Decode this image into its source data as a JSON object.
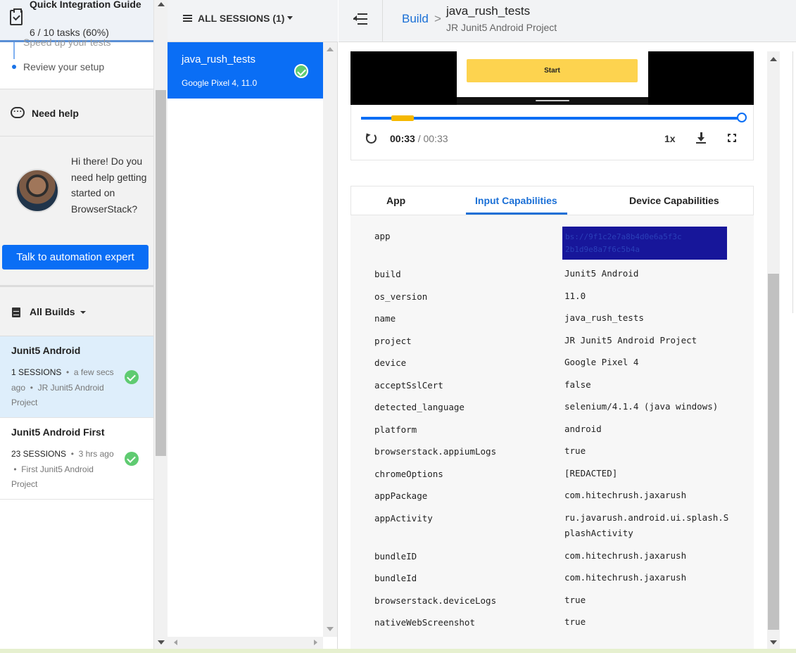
{
  "sidebar": {
    "guide": {
      "title": "Quick Integration Guide",
      "progress": "6 / 10 tasks (60%)",
      "prev_step": "Speed up your tests",
      "current_step": "Review your setup"
    },
    "help": {
      "heading": "Need help",
      "message": "Hi there! Do you need help getting started on BrowserStack?",
      "button": "Talk to automation expert"
    },
    "builds": {
      "heading": "All Builds",
      "items": [
        {
          "name": "Junit5 Android",
          "count": "1 SESSIONS",
          "meta": "a few secs ago",
          "project": "JR Junit5 Android Project"
        },
        {
          "name": "Junit5 Android First",
          "count": "23 SESSIONS",
          "meta": "3 hrs ago",
          "project": "First Junit5 Android Project"
        }
      ]
    }
  },
  "sessions": {
    "header": "ALL SESSIONS (1)",
    "items": [
      {
        "name": "java_rush_tests",
        "device": "Google Pixel 4, 11.0"
      }
    ]
  },
  "topbar": {
    "crumb_build": "Build",
    "crumb_sep": ">",
    "title": "java_rush_tests",
    "subtitle": "JR Junit5 Android Project"
  },
  "video": {
    "button_label": "Start",
    "current_time": "00:33",
    "total_time": "/ 00:33",
    "speed": "1x",
    "progress_fraction": 1.0
  },
  "tabs": {
    "app": "App",
    "input": "Input Capabilities",
    "device": "Device Capabilities",
    "active": "Input Capabilities"
  },
  "capabilities": [
    {
      "key": "app",
      "value": ""
    },
    {
      "key": "build",
      "value": "Junit5 Android"
    },
    {
      "key": "os_version",
      "value": "11.0"
    },
    {
      "key": "name",
      "value": "java_rush_tests"
    },
    {
      "key": "project",
      "value": "JR Junit5 Android Project"
    },
    {
      "key": "device",
      "value": "Google Pixel 4"
    },
    {
      "key": "acceptSslCert",
      "value": "false"
    },
    {
      "key": "detected_language",
      "value": "selenium/4.1.4 (java windows)"
    },
    {
      "key": "platform",
      "value": "android"
    },
    {
      "key": "browserstack.appiumLogs",
      "value": "true"
    },
    {
      "key": "chromeOptions",
      "value": "[REDACTED]"
    },
    {
      "key": "appPackage",
      "value": "com.hitechrush.jaxarush"
    },
    {
      "key": "appActivity",
      "value": "ru.javarush.android.ui.splash.SplashActivity"
    },
    {
      "key": "bundleID",
      "value": "com.hitechrush.jaxarush"
    },
    {
      "key": "bundleId",
      "value": "com.hitechrush.jaxarush"
    },
    {
      "key": "browserstack.deviceLogs",
      "value": "true"
    },
    {
      "key": "nativeWebScreenshot",
      "value": "true"
    }
  ],
  "colors": {
    "accent": "#0a6ef5",
    "link": "#1a6fd6",
    "success": "#5fcb71",
    "highlight": "#fdd34f",
    "redaction": "#17169a"
  }
}
